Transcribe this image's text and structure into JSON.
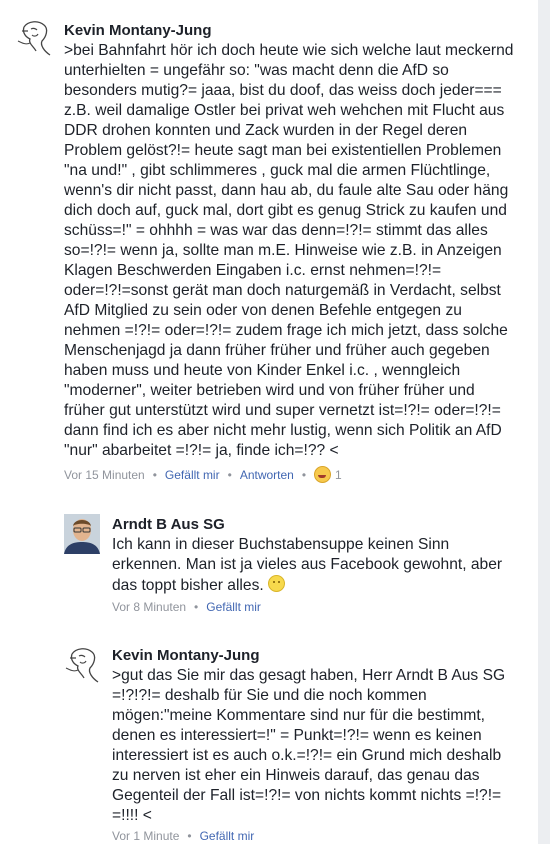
{
  "comments": [
    {
      "author": "Kevin Montany-Jung",
      "avatar_icon": "sketch-face-icon",
      "lines": [
        ">bei Bahnfahrt hör ich doch heute wie sich welche laut meckernd",
        "unterhielten = ungefähr so:  \"was macht denn die AfD so",
        "besonders mutig?= jaaa, bist du doof, das weiss doch jeder===",
        "z.B. weil damalige  Ostler bei privat weh wehchen  mit Flucht aus",
        "DDR  drohen konnten und Zack wurden in der Regel deren",
        "Problem gelöst?!= heute sagt man bei existentiellen Problemen",
        "\"na und!\" , gibt schlimmeres , guck mal die armen Flüchtlinge,",
        "wenn's dir nicht passt, dann hau ab,  du faule alte Sau oder häng",
        "dich doch auf, guck mal, dort gibt es genug Strick zu kaufen und",
        "schüss=!\" = ohhhh = was war das denn=!?!=  stimmt das alles",
        "so=!?!= wenn ja, sollte man m.E.  Hinweise wie z.B. in Anzeigen",
        "Klagen Beschwerden Eingaben  i.c. ernst nehmen=!?!=",
        "oder=!?!=sonst gerät man doch naturgemäß in Verdacht, selbst",
        "AfD Mitglied zu sein oder von denen Befehle entgegen zu",
        "nehmen =!?!= oder=!?!= zudem frage ich mich jetzt, dass solche",
        "Menschenjagd ja dann früher früher und früher auch gegeben",
        "haben muss und heute von Kinder Enkel i.c. , wenngleich",
        "\"moderner\",  weiter betrieben wird und von früher früher und",
        "früher gut unterstützt wird und super vernetzt ist=!?!= oder=!?!=",
        "dann find ich es aber nicht mehr lustig, wenn sich Politik an AfD",
        "\"nur\" abarbeitet =!?!= ja, finde ich=!?? <"
      ],
      "time": "Vor 15 Minuten",
      "like_label": "Gefällt mir",
      "reply_label": "Antworten",
      "reaction_icon": "laughing-emoji-icon",
      "reaction_count": "1"
    },
    {
      "author": "Arndt B Aus SG",
      "avatar_icon": "profile-photo-icon",
      "lines": [
        "Ich kann in dieser Buchstabensuppe keinen Sinn",
        "erkennen. Man ist ja vieles aus Facebook gewohnt, aber",
        "das toppt bisher alles."
      ],
      "inline_emoji": "hushed-emoji-icon",
      "time": "Vor 8 Minuten",
      "like_label": "Gefällt mir"
    },
    {
      "author": "Kevin Montany-Jung",
      "avatar_icon": "sketch-face-icon",
      "lines": [
        ">gut das Sie mir das gesagt haben, Herr Arndt B Aus SG",
        "=!?!?!=  deshalb für Sie und die noch kommen",
        "mögen:\"meine Kommentare sind nur für die bestimmt,",
        "denen es interessiert=!\" = Punkt=!?!= wenn es keinen",
        "interessiert ist es auch  o.k.=!?!= ein Grund mich deshalb",
        "zu nerven ist eher ein Hinweis darauf, das genau das",
        "Gegenteil der Fall ist=!?!= von nichts kommt nichts =!?!=",
        "=!!!! <"
      ],
      "time": "Vor 1 Minute",
      "like_label": "Gefällt mir"
    }
  ]
}
